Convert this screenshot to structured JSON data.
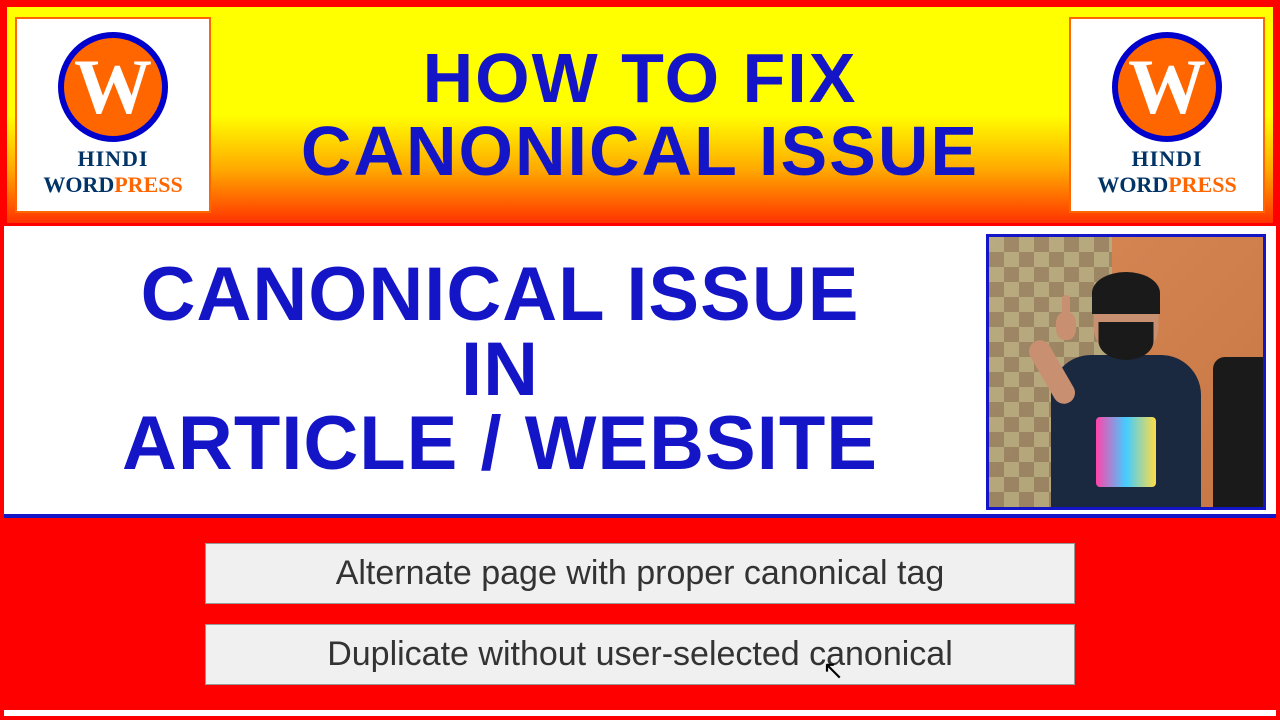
{
  "banner": {
    "line1": "HOW TO FIX",
    "line2": "CANONICAL ISSUE"
  },
  "logo": {
    "letter": "W",
    "text1": "HINDI",
    "text2a": "WORD",
    "text2b": "PRESS"
  },
  "middle": {
    "line1": "CANONICAL ISSUE",
    "line2": "IN",
    "line3": "ARTICLE / WEBSITE"
  },
  "messages": {
    "msg1": "Alternate page with proper canonical tag",
    "msg2": "Duplicate without user-selected canonical"
  }
}
